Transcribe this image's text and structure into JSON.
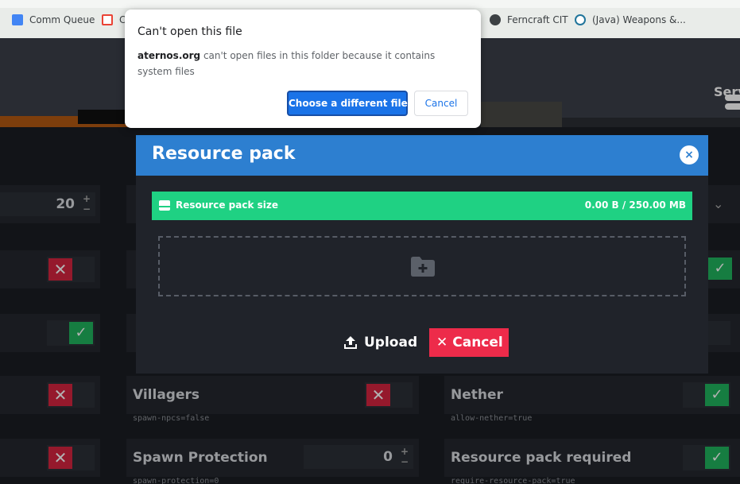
{
  "bookmarks": [
    {
      "label": "Comm Queue",
      "icon": "doc-icon",
      "color": "#4285f4"
    },
    {
      "label": "C",
      "icon": "gmail-icon",
      "color": "#ea4335"
    },
    {
      "label": "Ferncraft CIT",
      "icon": "globe-icon",
      "color": "#3c4043"
    },
    {
      "label": "(Java) Weapons &...",
      "icon": "wordpress-icon",
      "color": "#21759b"
    }
  ],
  "header": {
    "nav_label": "Serv"
  },
  "options": {
    "left_stepper_value": "20",
    "villagers": {
      "name": "Villagers",
      "key": "spawn-npcs=false"
    },
    "spawn_protection": {
      "name": "Spawn Protection",
      "key": "spawn-protection=0",
      "value": "0"
    },
    "nether": {
      "name": "Nether",
      "key": "allow-nether=true"
    },
    "resource_pack_required": {
      "name": "Resource pack required",
      "key": "require-resource-pack=true"
    }
  },
  "modal": {
    "title": "Resource pack",
    "close_icon": "×",
    "size_label": "Resource pack size",
    "size_value": "0.00 B / 250.00 MB",
    "upload_label": "Upload",
    "cancel_label": "Cancel",
    "accent": "#2d7fd0",
    "size_bar_color": "#1fd183",
    "cancel_color": "#ed2b4a"
  },
  "dialog": {
    "title": "Can't open this file",
    "domain": "aternos.org",
    "message": " can't open files in this folder because it contains system files",
    "choose_label": "Choose a different file",
    "cancel_label": "Cancel"
  }
}
